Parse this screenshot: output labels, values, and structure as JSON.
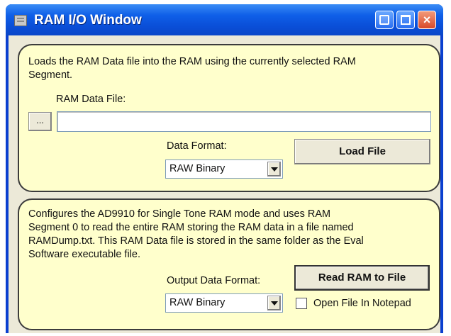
{
  "window": {
    "title": "RAM I/O Window",
    "icons": [
      "app-icon",
      "minimize-icon",
      "maximize-icon",
      "close-icon"
    ]
  },
  "load_section": {
    "description_line1": "Loads the RAM Data file into the RAM using the currently selected RAM",
    "description_line2": "Segment.",
    "file_label": "RAM Data File:",
    "browse_label": "...",
    "file_value": "",
    "format_label": "Data Format:",
    "format_value": "RAW Binary",
    "load_button": "Load File"
  },
  "read_section": {
    "description_line1": "Configures the AD9910 for Single Tone RAM mode and uses RAM",
    "description_line2": "Segment 0 to read the entire RAM storing the RAM data in a file named",
    "description_line3": "RAMDump.txt. This RAM Data file is stored in the same folder as the Eval",
    "description_line4": "Software executable file.",
    "output_format_label": "Output Data Format:",
    "output_format_value": "RAW Binary",
    "read_button": "Read RAM to File",
    "open_notepad_label": "Open File In Notepad",
    "open_notepad_checked": false
  },
  "colors": {
    "titlebar": "#0a4fd8",
    "group_background": "#ffffcc",
    "client_background": "#ece9d8",
    "close_button": "#d8492a"
  }
}
